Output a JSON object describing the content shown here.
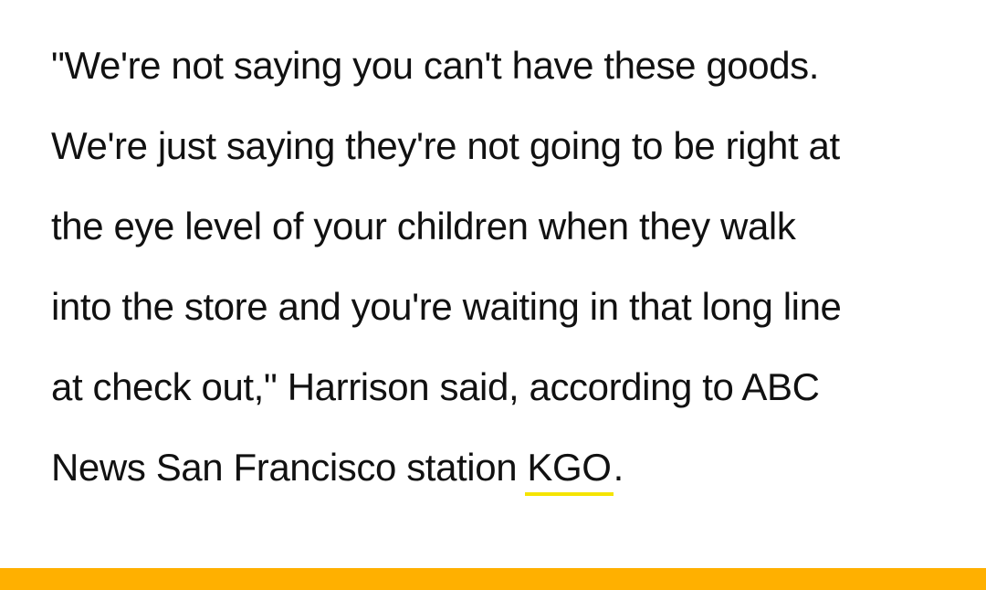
{
  "article": {
    "lines": [
      "\"We're not saying you can't have these goods.",
      "We're just saying they're not going to be right at",
      "the eye level of your children when they walk",
      "into the store and you're waiting in that long line",
      "at check out,\" Harrison said, according to ABC",
      "News San Francisco station "
    ],
    "link_text": "KGO",
    "trailing_text": "."
  },
  "colors": {
    "text": "#111111",
    "link_underline": "#f5e400",
    "accent_bar": "#ffb000"
  }
}
